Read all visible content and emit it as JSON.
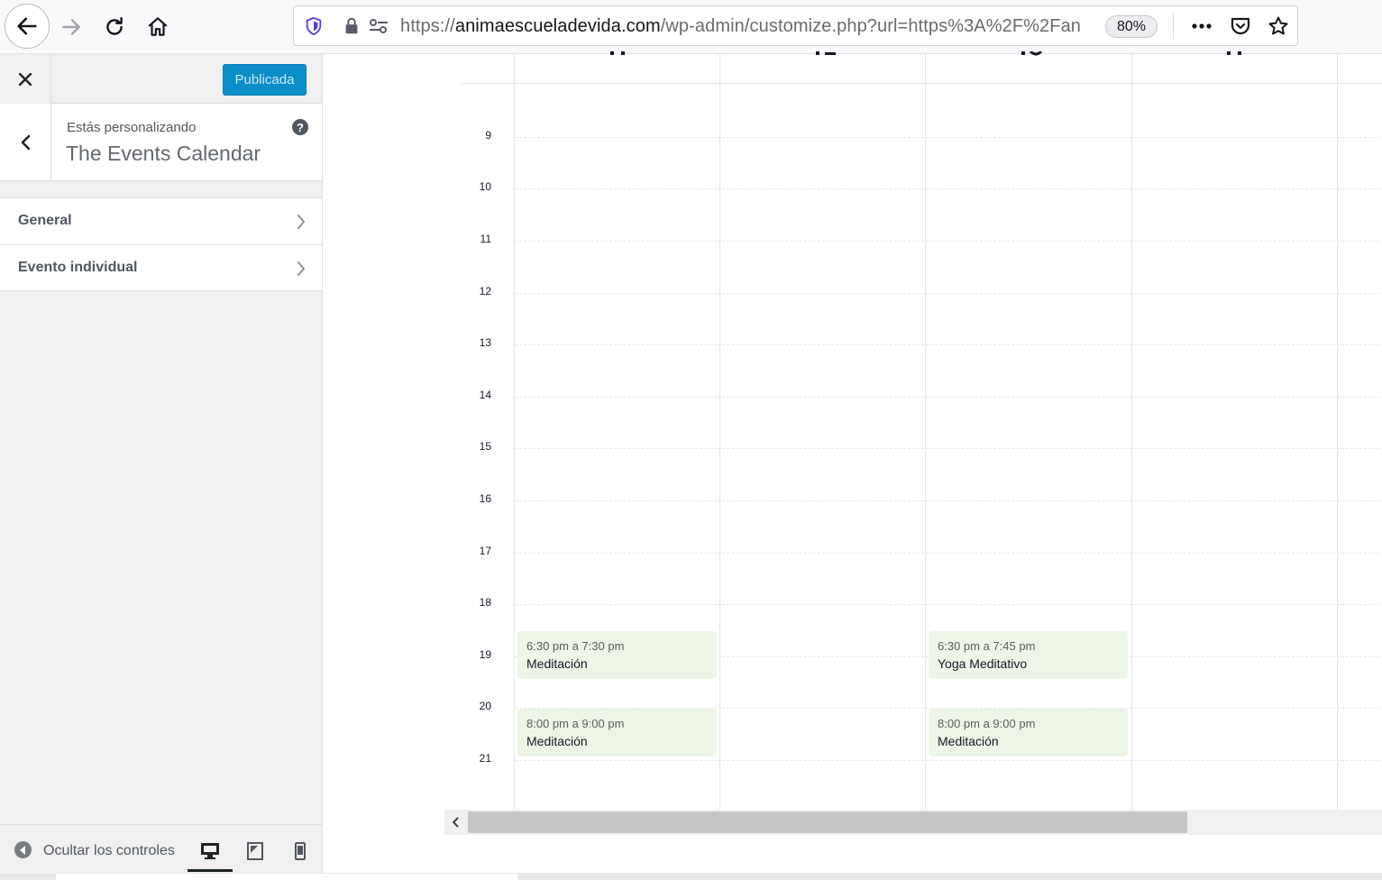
{
  "browser": {
    "url_prefix": "https://",
    "url_host": "animaescueladevida.com",
    "url_path": "/wp-admin/customize.php?url=https%3A%2F%2Fan",
    "zoom": "80%"
  },
  "sidebar": {
    "publish_label": "Publicada",
    "customizing_label": "Estás personalizando",
    "customizing_title": "The Events Calendar",
    "sections": [
      {
        "label": "General"
      },
      {
        "label": "Evento individual"
      }
    ],
    "collapse_label": "Ocultar los controles"
  },
  "calendar": {
    "hours": [
      "9",
      "10",
      "11",
      "12",
      "13",
      "14",
      "15",
      "16",
      "17",
      "18",
      "19",
      "20",
      "21"
    ],
    "events": [
      {
        "time": "6:30 pm a 7:30 pm",
        "title": "Meditación"
      },
      {
        "time": "8:00 pm a 9:00 pm",
        "title": "Meditación"
      },
      {
        "time": "6:30 pm a 7:45 pm",
        "title": "Yoga Meditativo"
      },
      {
        "time": "8:00 pm a 9:00 pm",
        "title": "Meditación"
      }
    ]
  },
  "colors": {
    "publish_button": "#0a8ec7",
    "event_background": "#edf5e6",
    "sidebar_background": "#f0f0f1"
  }
}
